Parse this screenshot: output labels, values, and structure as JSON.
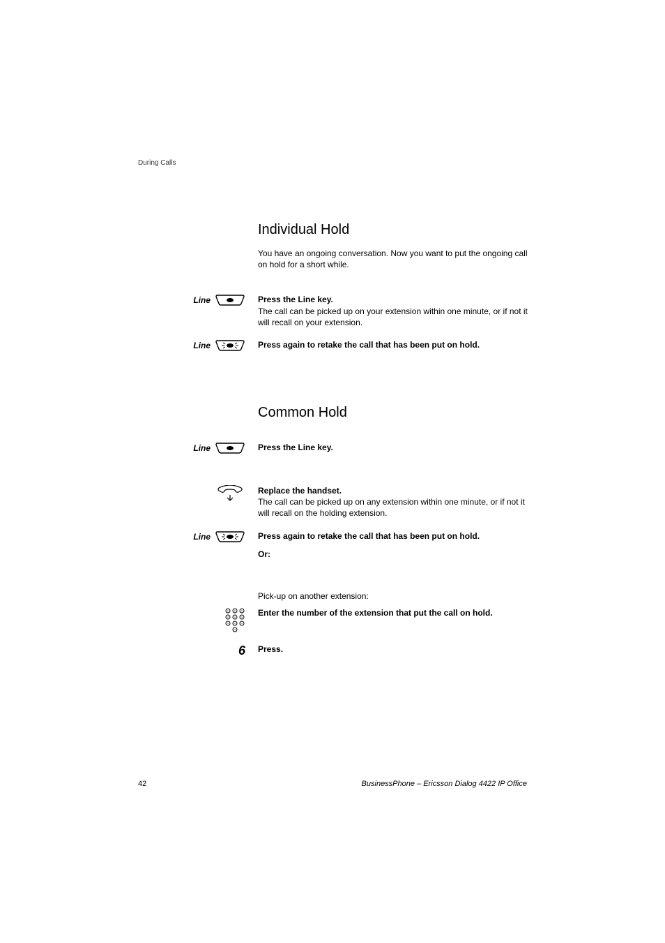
{
  "header": {
    "section_label": "During Calls"
  },
  "section1": {
    "heading": "Individual Hold",
    "intro": "You have an ongoing conversation. Now you want to put the ongoing call on hold for a short while.",
    "step1_line_label": "Line",
    "step1_bold": "Press the Line key.",
    "step1_text": "The call can be picked up on your extension within one minute, or if not it will recall on your extension.",
    "step2_line_label": "Line",
    "step2_bold": "Press again to retake the call that has been put on hold."
  },
  "section2": {
    "heading": "Common Hold",
    "step1_line_label": "Line",
    "step1_bold": "Press the Line key.",
    "step2_bold": "Replace the handset.",
    "step2_text": "The call can be picked up on any extension within one minute, or if not it will recall on the holding extension.",
    "step3_line_label": "Line",
    "step3_bold": "Press again to retake the call that has been put on hold.",
    "or_label": "Or:",
    "pickup_text": "Pick-up on another extension:",
    "keypad_bold": "Enter the number of the extension that put the call on hold.",
    "digit6": "6",
    "press_bold": "Press."
  },
  "footer": {
    "page": "42",
    "title": "BusinessPhone – Ericsson Dialog 4422 IP Office"
  }
}
